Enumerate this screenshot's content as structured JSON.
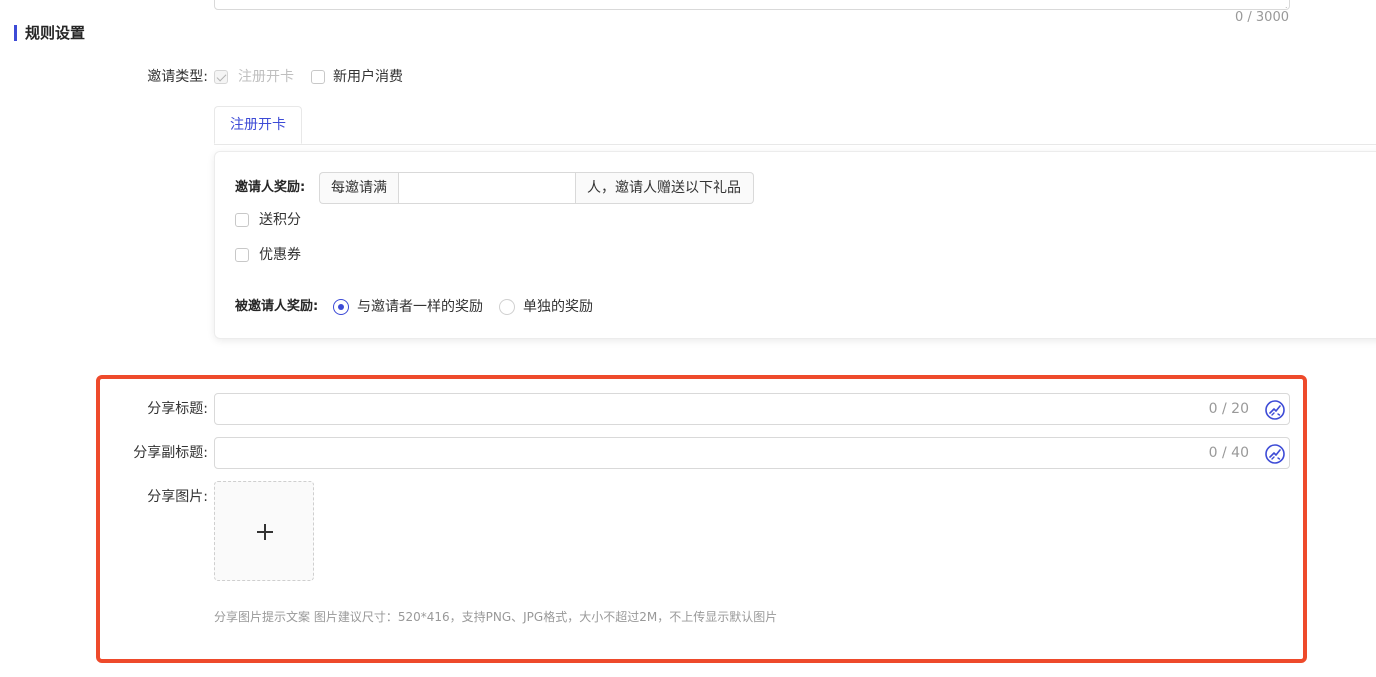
{
  "top": {
    "char_counter": "0 / 3000"
  },
  "section": {
    "title": "规则设置"
  },
  "invite_type": {
    "label": "邀请类型:",
    "options": [
      {
        "label": "注册开卡",
        "checked": true,
        "disabled": true
      },
      {
        "label": "新用户消费",
        "checked": false,
        "disabled": false
      }
    ]
  },
  "tabs": [
    {
      "label": "注册开卡",
      "active": true
    }
  ],
  "rule_card": {
    "inviter_reward_label": "邀请人奖励:",
    "prefix_addon": "每邀请满",
    "count_value": "",
    "suffix_addon": "人，邀请人赠送以下礼品",
    "gift_options": [
      {
        "label": "送积分",
        "checked": false
      },
      {
        "label": "优惠券",
        "checked": false
      }
    ],
    "invitee_reward_label": "被邀请人奖励:",
    "invitee_options": [
      {
        "label": "与邀请者一样的奖励",
        "checked": true
      },
      {
        "label": "单独的奖励",
        "checked": false
      }
    ]
  },
  "share": {
    "title_label": "分享标题:",
    "title_value": "",
    "title_counter": "0 / 20",
    "subtitle_label": "分享副标题:",
    "subtitle_value": "",
    "subtitle_counter": "0 / 40",
    "image_label": "分享图片:",
    "hint": "分享图片提示文案 图片建议尺寸：520*416，支持PNG、JPG格式，大小不超过2M，不上传显示默认图片"
  },
  "colors": {
    "accent": "#3d4bd6",
    "highlight_border": "#ee4a2b",
    "muted_text": "#999999"
  },
  "icons": {
    "ai_assist": "magic-wand-icon",
    "upload": "plus-icon",
    "checkbox_checked": "check-icon"
  }
}
